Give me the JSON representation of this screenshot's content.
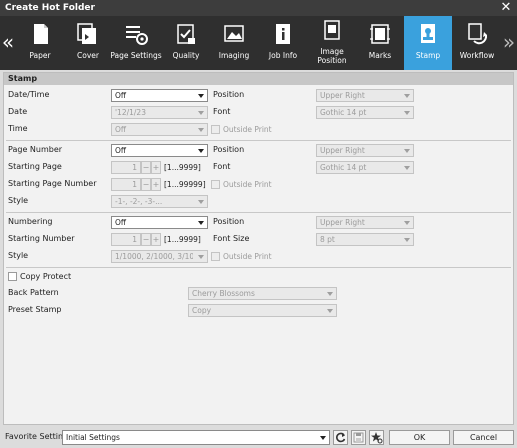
{
  "window": {
    "title": "Create Hot Folder"
  },
  "toolbar": {
    "items": [
      {
        "label": "Paper",
        "icon": "paper-icon"
      },
      {
        "label": "Cover",
        "icon": "cover-icon"
      },
      {
        "label": "Page Settings",
        "icon": "page-settings-icon"
      },
      {
        "label": "Quality",
        "icon": "quality-icon"
      },
      {
        "label": "Imaging",
        "icon": "imaging-icon"
      },
      {
        "label": "Job Info",
        "icon": "job-info-icon"
      },
      {
        "label": "Image Position",
        "icon": "image-position-icon"
      },
      {
        "label": "Marks",
        "icon": "marks-icon"
      },
      {
        "label": "Stamp",
        "icon": "stamp-icon",
        "active": true
      },
      {
        "label": "Workflow",
        "icon": "workflow-icon"
      }
    ],
    "accent_color": "#3aa1dd"
  },
  "panel": {
    "title": "Stamp",
    "date_time": {
      "label": "Date/Time",
      "value": "Off",
      "position_label": "Position",
      "position_value": "Upper Right",
      "date_label": "Date",
      "date_value": "'12/1/23",
      "font_label": "Font",
      "font_value": "Gothic 14 pt",
      "time_label": "Time",
      "time_value": "Off",
      "outside_print_label": "Outside Print"
    },
    "page_number": {
      "label": "Page Number",
      "value": "Off",
      "position_label": "Position",
      "position_value": "Upper Right",
      "starting_page_label": "Starting Page",
      "starting_page_value": "1",
      "starting_page_range": "[1...9999]",
      "font_label": "Font",
      "font_value": "Gothic 14 pt",
      "starting_page_number_label": "Starting Page Number",
      "starting_page_number_value": "1",
      "starting_page_number_range": "[1...99999]",
      "outside_print_label": "Outside Print",
      "style_label": "Style",
      "style_value": "-1-, -2-, -3-..."
    },
    "numbering": {
      "label": "Numbering",
      "value": "Off",
      "position_label": "Position",
      "position_value": "Upper Right",
      "starting_number_label": "Starting Number",
      "starting_number_value": "1",
      "starting_number_range": "[1...9999]",
      "font_size_label": "Font Size",
      "font_size_value": "8 pt",
      "style_label": "Style",
      "style_value": "1/1000, 2/1000, 3/10...",
      "outside_print_label": "Outside Print"
    },
    "copy_protect": {
      "label": "Copy Protect",
      "back_pattern_label": "Back Pattern",
      "back_pattern_value": "Cherry Blossoms",
      "preset_stamp_label": "Preset Stamp",
      "preset_stamp_value": "Copy"
    }
  },
  "footer": {
    "favorite_label": "Favorite Setting",
    "favorite_value": "Initial Settings",
    "ok_label": "OK",
    "cancel_label": "Cancel"
  }
}
